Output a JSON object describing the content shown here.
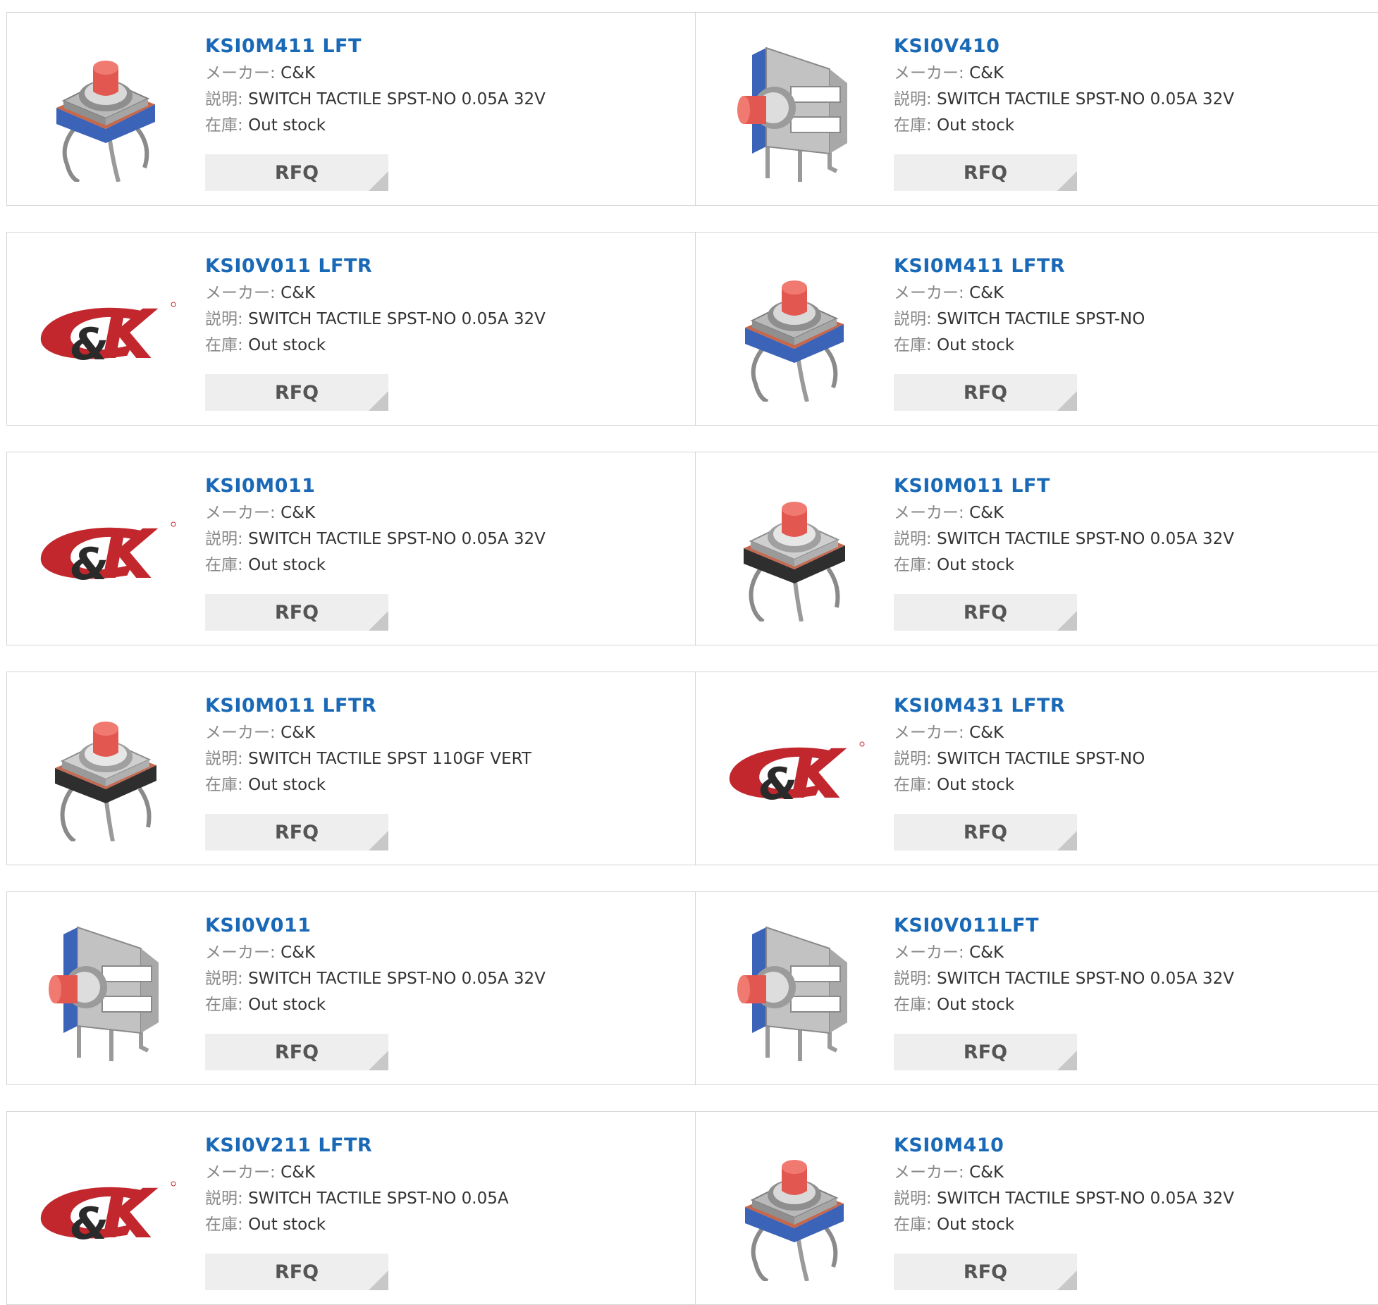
{
  "labels": {
    "maker": "メーカー:",
    "description": "説明:",
    "stock": "在庫:",
    "rfq": "RFQ"
  },
  "colors": {
    "link": "#1a69b7",
    "logo_red": "#c1272d",
    "border": "#d4d4d4",
    "button_bg": "#eeeeee"
  },
  "products": [
    {
      "name": "KSI0M411 LFT",
      "maker": "C&K",
      "desc": "SWITCH TACTILE SPST-NO 0.05A 32V",
      "stock": "Out stock",
      "image": "switch-top-blue-icon"
    },
    {
      "name": "KSI0V410",
      "maker": "C&K",
      "desc": "SWITCH TACTILE SPST-NO 0.05A 32V",
      "stock": "Out stock",
      "image": "switch-side-icon"
    },
    {
      "name": "KSI0V011 LFTR",
      "maker": "C&K",
      "desc": "SWITCH TACTILE SPST-NO 0.05A 32V",
      "stock": "Out stock",
      "image": "ck-logo-icon"
    },
    {
      "name": "KSI0M411 LFTR",
      "maker": "C&K",
      "desc": "SWITCH TACTILE SPST-NO",
      "stock": "Out stock",
      "image": "switch-top-blue-icon"
    },
    {
      "name": "KSI0M011",
      "maker": "C&K",
      "desc": "SWITCH TACTILE SPST-NO 0.05A 32V",
      "stock": "Out stock",
      "image": "ck-logo-icon"
    },
    {
      "name": "KSI0M011 LFT",
      "maker": "C&K",
      "desc": "SWITCH TACTILE SPST-NO 0.05A 32V",
      "stock": "Out stock",
      "image": "switch-top-black-icon"
    },
    {
      "name": "KSI0M011 LFTR",
      "maker": "C&K",
      "desc": "SWITCH TACTILE SPST 110GF VERT",
      "stock": "Out stock",
      "image": "switch-top-black-icon"
    },
    {
      "name": "KSI0M431 LFTR",
      "maker": "C&K",
      "desc": "SWITCH TACTILE SPST-NO",
      "stock": "Out stock",
      "image": "ck-logo-icon"
    },
    {
      "name": "KSI0V011",
      "maker": "C&K",
      "desc": "SWITCH TACTILE SPST-NO 0.05A 32V",
      "stock": "Out stock",
      "image": "switch-side-icon"
    },
    {
      "name": "KSI0V011LFT",
      "maker": "C&K",
      "desc": "SWITCH TACTILE SPST-NO 0.05A 32V",
      "stock": "Out stock",
      "image": "switch-side-icon"
    },
    {
      "name": "KSI0V211 LFTR",
      "maker": "C&K",
      "desc": "SWITCH TACTILE SPST-NO 0.05A",
      "stock": "Out stock",
      "image": "ck-logo-icon"
    },
    {
      "name": "KSI0M410",
      "maker": "C&K",
      "desc": "SWITCH TACTILE SPST-NO 0.05A 32V",
      "stock": "Out stock",
      "image": "switch-top-blue-icon"
    }
  ]
}
